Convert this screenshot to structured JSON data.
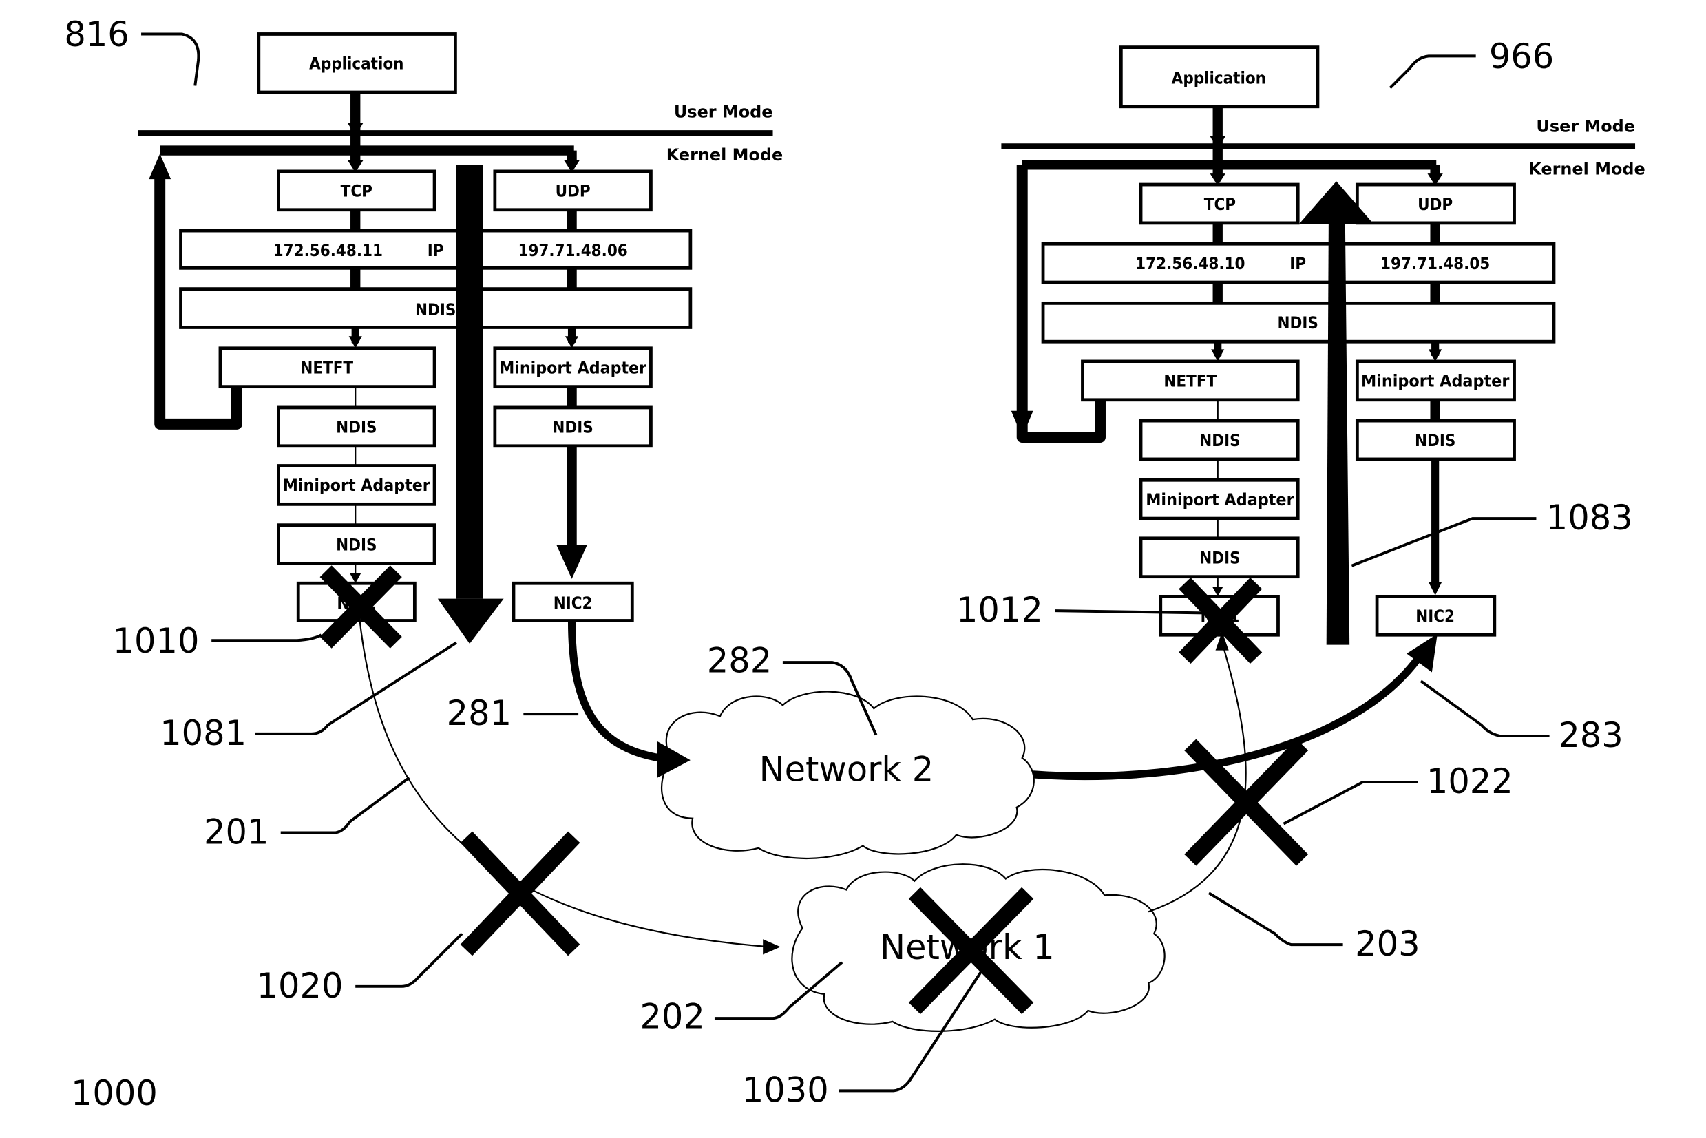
{
  "figure": {
    "figure_number": "1000",
    "left_host": {
      "ref": "816",
      "application": "Application",
      "user_mode": "User Mode",
      "kernel_mode": "Kernel Mode",
      "tcp": "TCP",
      "udp": "UDP",
      "ip_left": "172.56.48.11",
      "ip_label": "IP",
      "ip_right": "197.71.48.06",
      "ndis_main": "NDIS",
      "netft": "NETFT",
      "miniport_right": "Miniport Adapter",
      "ndis_left_1": "NDIS",
      "ndis_right": "NDIS",
      "miniport_left": "Miniport Adapter",
      "ndis_left_2": "NDIS",
      "nic1": "NIC1",
      "nic2": "NIC2"
    },
    "right_host": {
      "ref": "966",
      "application": "Application",
      "user_mode": "User Mode",
      "kernel_mode": "Kernel Mode",
      "tcp": "TCP",
      "udp": "UDP",
      "ip_left": "172.56.48.10",
      "ip_label": "IP",
      "ip_right": "197.71.48.05",
      "ndis_main": "NDIS",
      "netft": "NETFT",
      "miniport_right": "Miniport Adapter",
      "ndis_left_1": "NDIS",
      "ndis_right": "NDIS",
      "miniport_left": "Miniport Adapter",
      "ndis_left_2": "NDIS",
      "nic1": "NIC1",
      "nic2": "NIC2"
    },
    "networks": {
      "network1": "Network 1",
      "network2": "Network 2"
    },
    "reference_labels": {
      "r1010": "1010",
      "r1081": "1081",
      "r281": "281",
      "r282": "282",
      "r201": "201",
      "r1020": "1020",
      "r202": "202",
      "r1030": "1030",
      "r1012": "1012",
      "r1083": "1083",
      "r283": "283",
      "r1022": "1022",
      "r203": "203"
    }
  }
}
